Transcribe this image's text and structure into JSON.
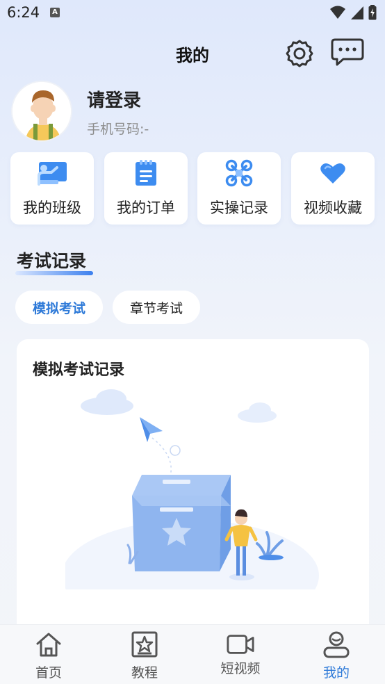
{
  "status": {
    "time": "6:24",
    "notif_letter": "A"
  },
  "header": {
    "title": "我的"
  },
  "profile": {
    "login_text": "请登录",
    "phone_text": "手机号码:-"
  },
  "quick_actions": [
    {
      "label": "我的班级",
      "icon": "classroom-icon"
    },
    {
      "label": "我的订单",
      "icon": "order-clipboard-icon"
    },
    {
      "label": "实操记录",
      "icon": "drone-icon"
    },
    {
      "label": "视频收藏",
      "icon": "heart-icon"
    }
  ],
  "exam": {
    "section_title": "考试记录",
    "tabs": [
      {
        "label": "模拟考试",
        "active": true
      },
      {
        "label": "章节考试",
        "active": false
      }
    ],
    "card_title": "模拟考试记录"
  },
  "nav": [
    {
      "label": "首页",
      "icon": "home-icon",
      "active": false
    },
    {
      "label": "教程",
      "icon": "tutorial-icon",
      "active": false
    },
    {
      "label": "短视频",
      "icon": "video-icon",
      "active": false
    },
    {
      "label": "我的",
      "icon": "profile-icon",
      "active": true
    }
  ],
  "colors": {
    "accent": "#2e7ad8",
    "icon_blue": "#3d8cf0"
  }
}
